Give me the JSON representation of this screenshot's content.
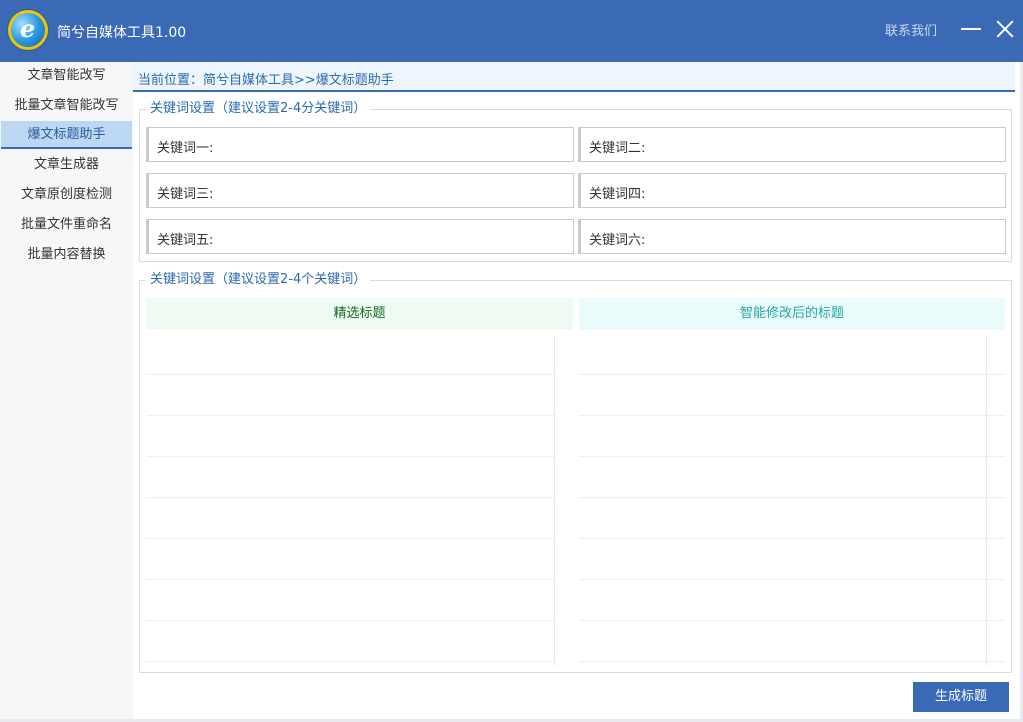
{
  "window": {
    "app_title": "简兮自媒体工具1.00",
    "contact_label": "联系我们",
    "logo_icon": "app-logo-icon",
    "minimize_icon": "minimize-icon",
    "close_icon": "close-icon"
  },
  "sidebar": {
    "items": [
      {
        "label": "文章智能改写",
        "active": false
      },
      {
        "label": "批量文章智能改写",
        "active": false
      },
      {
        "label": "爆文标题助手",
        "active": true
      },
      {
        "label": "文章生成器",
        "active": false
      },
      {
        "label": "文章原创度检测",
        "active": false
      },
      {
        "label": "批量文件重命名",
        "active": false
      },
      {
        "label": "批量内容替换",
        "active": false
      }
    ]
  },
  "breadcrumb": {
    "text": "当前位置：简兮自媒体工具>>爆文标题助手"
  },
  "keyword_group": {
    "legend": "关键词设置（建议设置2-4分关键词）",
    "fields": [
      {
        "label": "关键词一:",
        "value": ""
      },
      {
        "label": "关键词二:",
        "value": ""
      },
      {
        "label": "关键词三:",
        "value": ""
      },
      {
        "label": "关键词四:",
        "value": ""
      },
      {
        "label": "关键词五:",
        "value": ""
      },
      {
        "label": "关键词六:",
        "value": ""
      }
    ]
  },
  "results_group": {
    "legend": "关键词设置（建议设置2-4个关键词）",
    "columns": [
      "精选标题",
      "智能修改后的标题"
    ],
    "rows": []
  },
  "actions": {
    "generate_label": "生成标题"
  },
  "colors": {
    "brand": "#3a6ab6",
    "accent_text": "#2a6ab0",
    "left_header_text": "#0f6b1e",
    "right_header_text": "#27a8a0"
  }
}
